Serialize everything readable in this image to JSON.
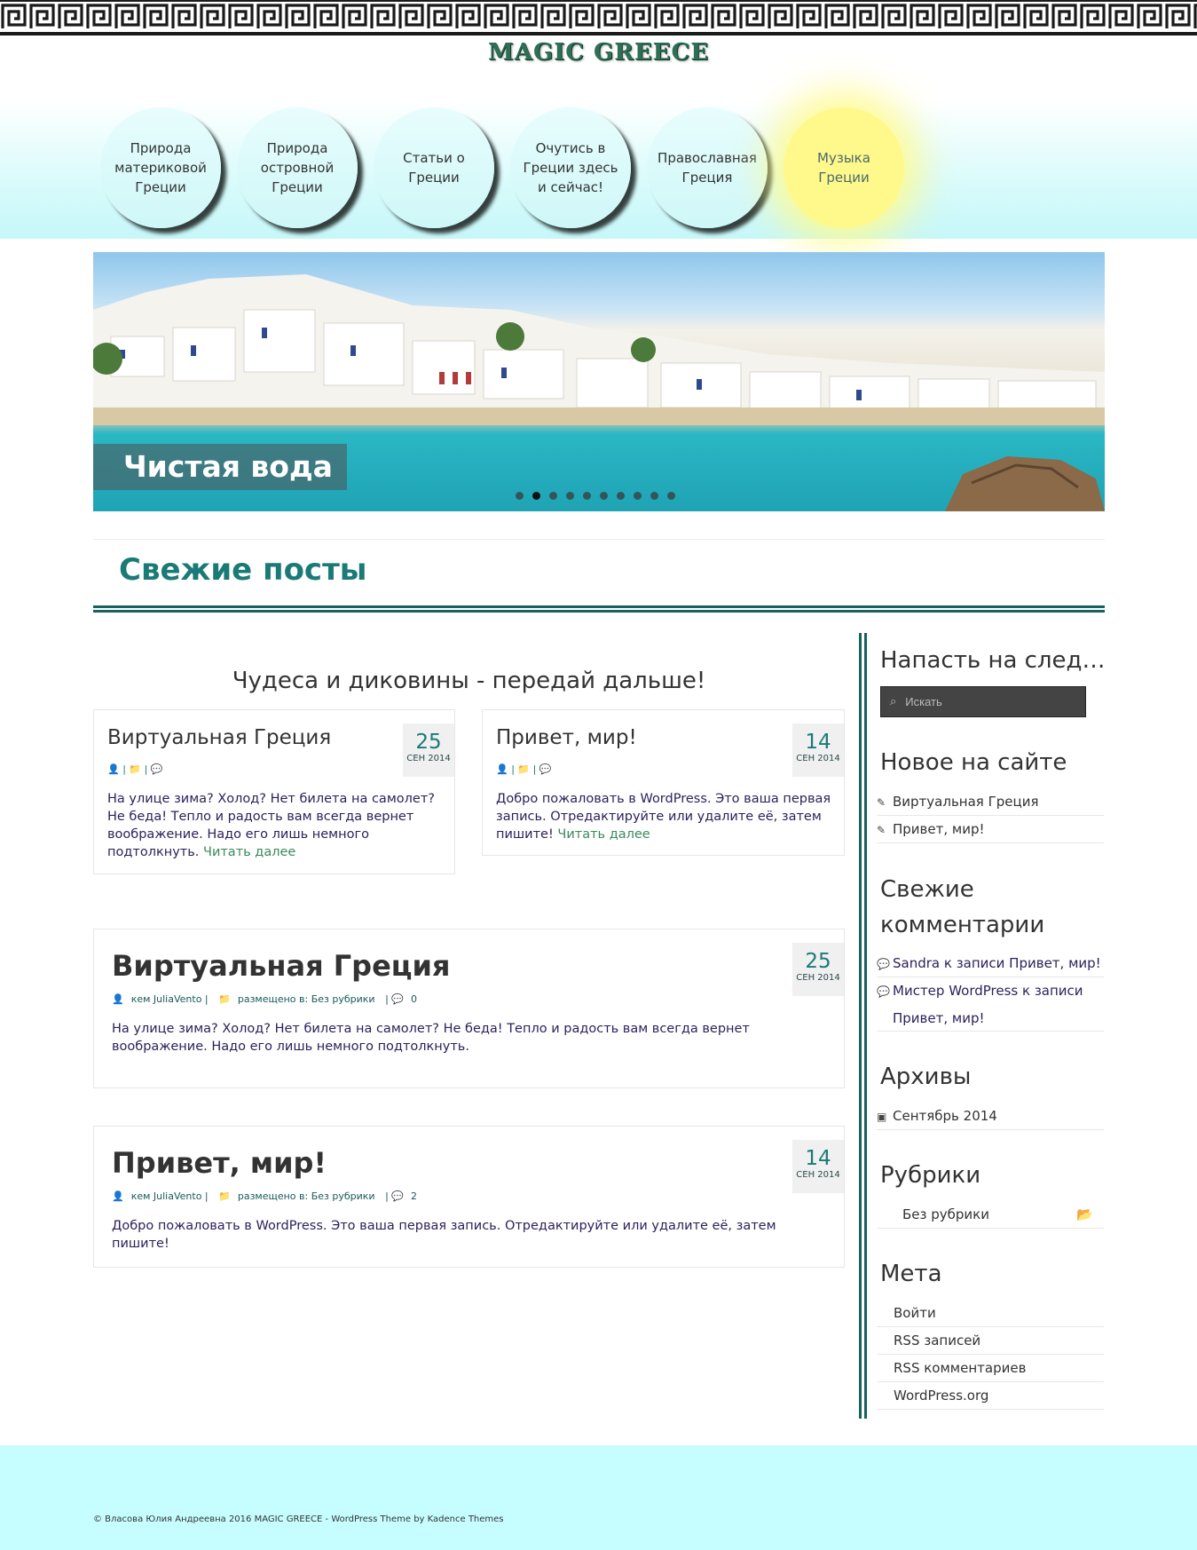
{
  "brand": "MAGIC GREECE",
  "nav": [
    {
      "label": "Природа материковой Греции"
    },
    {
      "label": "Природа островной Греции"
    },
    {
      "label": "Статьи о Греции"
    },
    {
      "label": "Очутись в Греции здесь и сейчас!"
    },
    {
      "label": "Православная Греция"
    },
    {
      "label": "Музыка Греции"
    }
  ],
  "hero": {
    "caption": "Чистая вода",
    "slides": 10,
    "active_slide": 2
  },
  "section_title": "Свежие посты",
  "featured": {
    "heading": "Чудеса и диковины - передай дальше!",
    "cards": [
      {
        "title": "Виртуальная Греция",
        "day": "25",
        "month": "СЕН 2014",
        "meta": "👤 | 📁 | 💬",
        "excerpt": "На улице зима? Холод? Нет билета на самолет? Не беда! Тепло и радость вам всегда вернет воображение. Надо его лишь немного подтолкнуть.",
        "more": "Читать далее"
      },
      {
        "title": "Привет, мир!",
        "day": "14",
        "month": "СЕН 2014",
        "meta": "👤 | 📁 | 💬",
        "excerpt": "Добро пожаловать в WordPress. Это ваша первая запись. Отредактируйте или удалите её, затем пишите!",
        "more": "Читать далее"
      }
    ]
  },
  "posts": [
    {
      "title": "Виртуальная Греция",
      "day": "25",
      "month": "СЕН 2014",
      "author": "кем JuliaVento |",
      "category": "размещено в: Без рубрики",
      "comments": "0",
      "body": "На улице зима? Холод? Нет билета на самолет? Не беда! Тепло и радость вам всегда вернет воображение. Надо его лишь немного подтолкнуть."
    },
    {
      "title": "Привет, мир!",
      "day": "14",
      "month": "СЕН 2014",
      "author": "кем JuliaVento |",
      "category": "размещено в: Без рубрики",
      "comments": "2",
      "body": "Добро пожаловать в WordPress. Это ваша первая запись. Отредактируйте или удалите её, затем пишите!"
    }
  ],
  "sidebar": {
    "search_title": "Напасть на след…",
    "search_placeholder": "Искать",
    "recent_title": "Новое на сайте",
    "recent": [
      "Виртуальная Греция",
      "Привет, мир!"
    ],
    "comments_title_1": "Свежие",
    "comments_title_2": "комментарии",
    "comment1": "Sandra к записи Привет, мир!",
    "comment2_a": "Мистер WordPress к записи",
    "comment2_b": "Привет, мир!",
    "archives_title": "Архивы",
    "archive": "Сентябрь 2014",
    "categories_title": "Рубрики",
    "category": "Без рубрики",
    "meta_title": "Мета",
    "meta": [
      "Войти",
      "RSS записей",
      "RSS комментариев",
      "WordPress.org"
    ]
  },
  "footer": "© Власова Юлия Андреевна 2016 MAGIC GREECE - WordPress Theme by Kadence Themes",
  "colors": {
    "accent": "#1a7a76",
    "rule": "#17625e",
    "footer_bg": "#c6feff",
    "active_nav": "#fff98c"
  }
}
